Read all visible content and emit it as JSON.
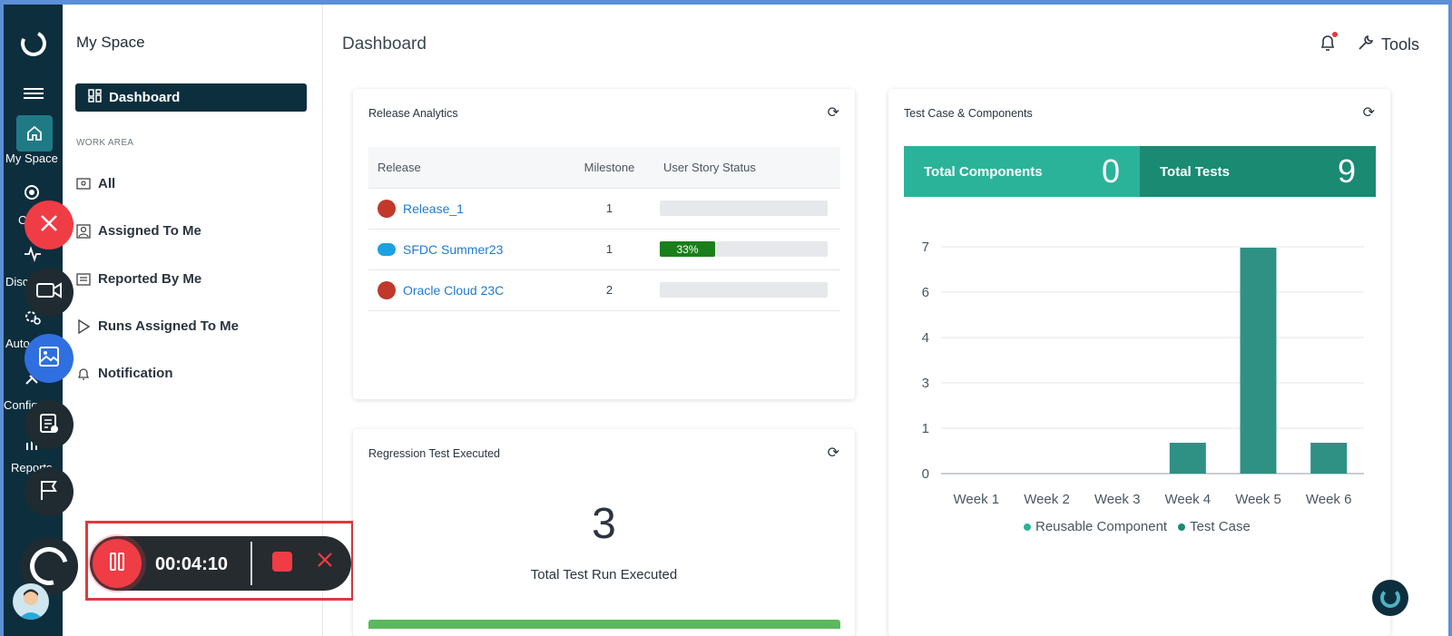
{
  "rail": {
    "labels": {
      "my_space": "My Space",
      "c": "C",
      "disc": "Disc",
      "auto": "Auto",
      "config": "Config",
      "reports": "Reports"
    }
  },
  "sidebar": {
    "title": "My Space",
    "active_item": "Dashboard",
    "section": "WORK AREA",
    "items": [
      {
        "label": "All",
        "icon": "all-icon"
      },
      {
        "label": "Assigned To Me",
        "icon": "assigned-icon"
      },
      {
        "label": "Reported By Me",
        "icon": "reported-icon"
      },
      {
        "label": "Runs Assigned To Me",
        "icon": "play-icon"
      },
      {
        "label": "Notification",
        "icon": "bell-icon"
      }
    ]
  },
  "recorder": {
    "time": "00:04:10"
  },
  "header": {
    "title": "Dashboard",
    "tools_label": "Tools"
  },
  "release_analytics": {
    "title": "Release Analytics",
    "columns": [
      "Release",
      "Milestone",
      "User Story Status"
    ],
    "rows": [
      {
        "name": "Release_1",
        "milestone": "1",
        "status_label": "",
        "status_pct": 0
      },
      {
        "name": "SFDC Summer23",
        "milestone": "1",
        "status_label": "33%",
        "status_pct": 0.33
      },
      {
        "name": "Oracle Cloud 23C",
        "milestone": "2",
        "status_label": "",
        "status_pct": 0
      }
    ]
  },
  "regression": {
    "title": "Regression Test Executed",
    "value": "3",
    "label": "Total Test Run Executed"
  },
  "test_case_components": {
    "title": "Test Case & Components",
    "total_components_label": "Total Components",
    "total_components_value": "0",
    "total_tests_label": "Total Tests",
    "total_tests_value": "9"
  },
  "colors": {
    "navy": "#0d2e3d",
    "teal": "#2bb39a",
    "teal_dark": "#1a8a73",
    "bar": "#2e9184",
    "red": "#f03c45"
  },
  "chart_data": {
    "type": "bar",
    "categories": [
      "Week 1",
      "Week 2",
      "Week 3",
      "Week 4",
      "Week 5",
      "Week 6"
    ],
    "series": [
      {
        "name": "Reusable Component",
        "values": [
          0,
          0,
          0,
          0,
          0,
          0
        ]
      },
      {
        "name": "Test Case",
        "values": [
          0,
          0,
          0,
          1,
          7,
          1
        ]
      }
    ],
    "ytick_labels": [
      "0",
      "1",
      "3",
      "4",
      "6",
      "7"
    ],
    "ylim": [
      0,
      7
    ],
    "legend_position": "bottom",
    "grid": true
  }
}
